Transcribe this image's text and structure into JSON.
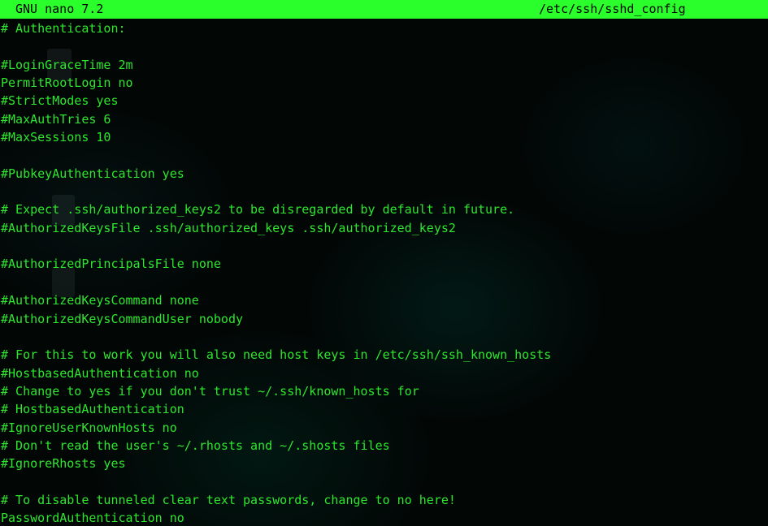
{
  "titlebar": {
    "app_version": "GNU nano 7.2",
    "file_path": "/etc/ssh/sshd_config"
  },
  "colors": {
    "title_bg": "#2bff2b",
    "text": "#2ee62e",
    "background": "#000000"
  },
  "editor": {
    "lines": [
      "# Authentication:",
      "",
      "#LoginGraceTime 2m",
      "PermitRootLogin no",
      "#StrictModes yes",
      "#MaxAuthTries 6",
      "#MaxSessions 10",
      "",
      "#PubkeyAuthentication yes",
      "",
      "# Expect .ssh/authorized_keys2 to be disregarded by default in future.",
      "#AuthorizedKeysFile .ssh/authorized_keys .ssh/authorized_keys2",
      "",
      "#AuthorizedPrincipalsFile none",
      "",
      "#AuthorizedKeysCommand none",
      "#AuthorizedKeysCommandUser nobody",
      "",
      "# For this to work you will also need host keys in /etc/ssh/ssh_known_hosts",
      "#HostbasedAuthentication no",
      "# Change to yes if you don't trust ~/.ssh/known_hosts for",
      "# HostbasedAuthentication",
      "#IgnoreUserKnownHosts no",
      "# Don't read the user's ~/.rhosts and ~/.shosts files",
      "#IgnoreRhosts yes",
      "",
      "# To disable tunneled clear text passwords, change to no here!",
      "PasswordAuthentication no"
    ]
  }
}
